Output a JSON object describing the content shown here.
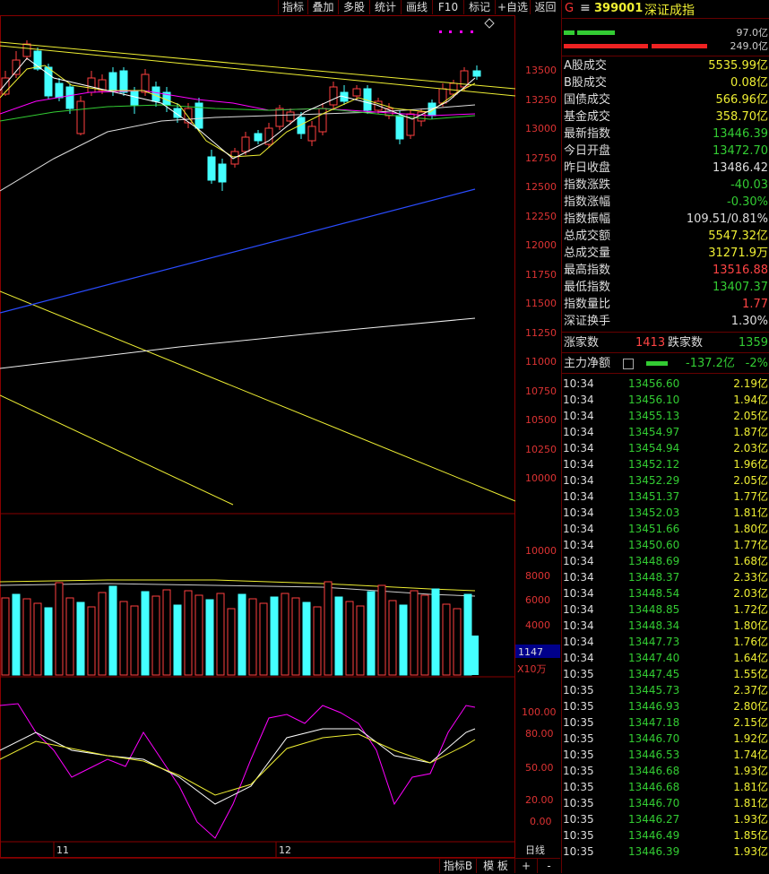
{
  "toolbar": {
    "buttons": [
      "指标",
      "叠加",
      "多股",
      "统计",
      "画线",
      "F10",
      "标记",
      "+自选",
      "返回"
    ]
  },
  "chart": {
    "price_axis": [
      "13500",
      "13250",
      "13000",
      "12750",
      "12500",
      "12250",
      "12000",
      "11750",
      "11500",
      "11250",
      "11000",
      "10750",
      "10500",
      "10250",
      "10000"
    ],
    "volume_axis": [
      "10000",
      "8000",
      "6000",
      "4000"
    ],
    "volume_readout": "1147",
    "volume_unit": "X10万",
    "osc_axis": [
      "100.00",
      "80.00",
      "50.00",
      "20.00",
      "0.00"
    ],
    "month_labels": [
      "11",
      "12"
    ],
    "period": "日线"
  },
  "bottombar": {
    "buttons": [
      "指标B",
      "模 板",
      "+",
      "-"
    ]
  },
  "panel": {
    "logo": "G",
    "menu_icon": "≡",
    "code": "399001",
    "name": "深证成指",
    "bar1_value": "97.0亿",
    "bar2_value": "249.0亿",
    "stats": [
      {
        "label": "A股成交",
        "value": "5535.99亿",
        "color": "#ee3"
      },
      {
        "label": "B股成交",
        "value": "0.08亿",
        "color": "#ee3"
      },
      {
        "label": "国债成交",
        "value": "566.96亿",
        "color": "#ee3"
      },
      {
        "label": "基金成交",
        "value": "358.70亿",
        "color": "#ee3"
      },
      {
        "label": "最新指数",
        "value": "13446.39",
        "color": "#3c3"
      },
      {
        "label": "今日开盘",
        "value": "13472.70",
        "color": "#3c3"
      },
      {
        "label": "昨日收盘",
        "value": "13486.42",
        "color": "#ddd"
      },
      {
        "label": "指数涨跌",
        "value": "-40.03",
        "color": "#3c3"
      },
      {
        "label": "指数涨幅",
        "value": "-0.30%",
        "color": "#3c3"
      },
      {
        "label": "指数振幅",
        "value": "109.51/0.81%",
        "color": "#ddd"
      },
      {
        "label": "总成交额",
        "value": "5547.32亿",
        "color": "#ee3"
      },
      {
        "label": "总成交量",
        "value": "31271.9万",
        "color": "#ee3"
      },
      {
        "label": "最高指数",
        "value": "13516.88",
        "color": "#f44"
      },
      {
        "label": "最低指数",
        "value": "13407.37",
        "color": "#3c3"
      },
      {
        "label": "指数量比",
        "value": "1.77",
        "color": "#f44"
      },
      {
        "label": "深证换手",
        "value": "1.30%",
        "color": "#ddd"
      }
    ],
    "up_label": "涨家数",
    "up_count": "1413",
    "down_label": "跌家数",
    "down_count": "1359",
    "main_label": "主力净额",
    "main_value": "-137.2亿",
    "main_pct": "-2%",
    "ticks": [
      {
        "t": "10:34",
        "p": "13456.60",
        "v": "2.19亿"
      },
      {
        "t": "10:34",
        "p": "13456.10",
        "v": "1.94亿"
      },
      {
        "t": "10:34",
        "p": "13455.13",
        "v": "2.05亿"
      },
      {
        "t": "10:34",
        "p": "13454.97",
        "v": "1.87亿"
      },
      {
        "t": "10:34",
        "p": "13454.94",
        "v": "2.03亿"
      },
      {
        "t": "10:34",
        "p": "13452.12",
        "v": "1.96亿"
      },
      {
        "t": "10:34",
        "p": "13452.29",
        "v": "2.05亿"
      },
      {
        "t": "10:34",
        "p": "13451.37",
        "v": "1.77亿"
      },
      {
        "t": "10:34",
        "p": "13452.03",
        "v": "1.81亿"
      },
      {
        "t": "10:34",
        "p": "13451.66",
        "v": "1.80亿"
      },
      {
        "t": "10:34",
        "p": "13450.60",
        "v": "1.77亿"
      },
      {
        "t": "10:34",
        "p": "13448.69",
        "v": "1.68亿"
      },
      {
        "t": "10:34",
        "p": "13448.37",
        "v": "2.33亿"
      },
      {
        "t": "10:34",
        "p": "13448.54",
        "v": "2.03亿"
      },
      {
        "t": "10:34",
        "p": "13448.85",
        "v": "1.72亿"
      },
      {
        "t": "10:34",
        "p": "13448.34",
        "v": "1.80亿"
      },
      {
        "t": "10:34",
        "p": "13447.73",
        "v": "1.76亿"
      },
      {
        "t": "10:34",
        "p": "13447.40",
        "v": "1.64亿"
      },
      {
        "t": "10:35",
        "p": "13447.45",
        "v": "1.55亿"
      },
      {
        "t": "10:35",
        "p": "13445.73",
        "v": "2.37亿"
      },
      {
        "t": "10:35",
        "p": "13446.93",
        "v": "2.80亿"
      },
      {
        "t": "10:35",
        "p": "13447.18",
        "v": "2.15亿"
      },
      {
        "t": "10:35",
        "p": "13446.70",
        "v": "1.92亿"
      },
      {
        "t": "10:35",
        "p": "13446.53",
        "v": "1.74亿"
      },
      {
        "t": "10:35",
        "p": "13446.68",
        "v": "1.93亿"
      },
      {
        "t": "10:35",
        "p": "13446.68",
        "v": "1.81亿"
      },
      {
        "t": "10:35",
        "p": "13446.70",
        "v": "1.81亿"
      },
      {
        "t": "10:35",
        "p": "13446.27",
        "v": "1.93亿"
      },
      {
        "t": "10:35",
        "p": "13446.49",
        "v": "1.85亿"
      },
      {
        "t": "10:35",
        "p": "13446.39",
        "v": "1.93亿"
      }
    ]
  }
}
